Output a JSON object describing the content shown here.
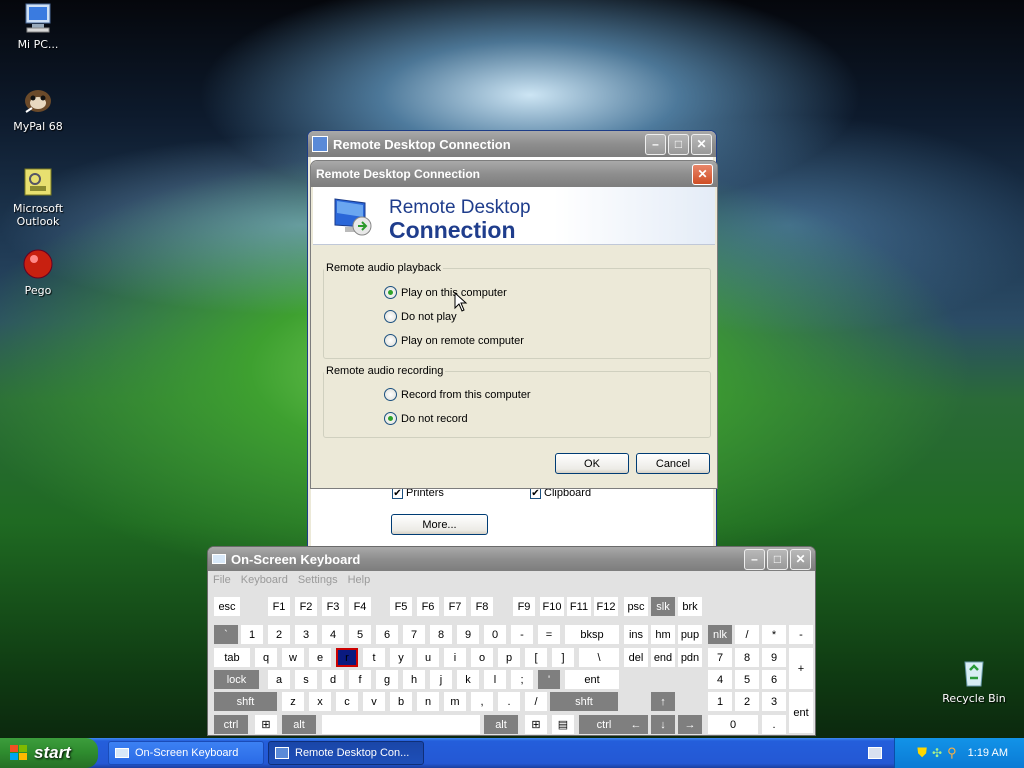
{
  "desktop": {
    "icons": [
      {
        "label": "Mi PC...",
        "icon": "my-computer-icon"
      },
      {
        "label": "MyPal 68",
        "icon": "mypal-browser-icon"
      },
      {
        "label": "Microsoft Outlook",
        "icon": "outlook-icon"
      },
      {
        "label": "Pego",
        "icon": "pego-icon"
      },
      {
        "label": "Recycle Bin",
        "icon": "recycle-bin-icon"
      }
    ]
  },
  "rdc_main": {
    "title": "Remote Desktop Connection",
    "printers_label": "Printers",
    "clipboard_label": "Clipboard",
    "more_button": "More..."
  },
  "audio_dialog": {
    "title": "Remote Desktop Connection",
    "header_line1": "Remote Desktop",
    "header_line2": "Connection",
    "playback_group": "Remote audio playback",
    "playback_options": [
      "Play on this computer",
      "Do not play",
      "Play on remote computer"
    ],
    "playback_selected": 0,
    "recording_group": "Remote audio recording",
    "recording_options": [
      "Record from this computer",
      "Do not record"
    ],
    "recording_selected": 1,
    "ok_button": "OK",
    "cancel_button": "Cancel"
  },
  "osk": {
    "title": "On-Screen Keyboard",
    "menu": [
      "File",
      "Keyboard",
      "Settings",
      "Help"
    ],
    "rows": {
      "r1": [
        "esc",
        "F1",
        "F2",
        "F3",
        "F4",
        "F5",
        "F6",
        "F7",
        "F8",
        "F9",
        "F10",
        "F11",
        "F12",
        "psc",
        "slk",
        "brk"
      ],
      "r2": [
        "`",
        "1",
        "2",
        "3",
        "4",
        "5",
        "6",
        "7",
        "8",
        "9",
        "0",
        "-",
        "=",
        "bksp",
        "ins",
        "hm",
        "pup",
        "nlk",
        "/",
        "*",
        "-"
      ],
      "r3": [
        "tab",
        "q",
        "w",
        "e",
        "r",
        "t",
        "y",
        "u",
        "i",
        "o",
        "p",
        "[",
        "]",
        "\\",
        "del",
        "end",
        "pdn",
        "7",
        "8",
        "9",
        "+"
      ],
      "r4": [
        "lock",
        "a",
        "s",
        "d",
        "f",
        "g",
        "h",
        "j",
        "k",
        "l",
        ";",
        "'",
        "ent",
        "4",
        "5",
        "6"
      ],
      "r5": [
        "shft",
        "z",
        "x",
        "c",
        "v",
        "b",
        "n",
        "m",
        ",",
        ".",
        "/",
        "shft",
        "↑",
        "1",
        "2",
        "3",
        "ent"
      ],
      "r6": [
        "ctrl",
        "⊞",
        "alt",
        "",
        "alt",
        "⊞",
        "▤",
        "ctrl",
        "←",
        "↓",
        "→",
        "0",
        "."
      ]
    }
  },
  "taskbar": {
    "start_label": "start",
    "tasks": [
      "On-Screen Keyboard",
      "Remote Desktop Con..."
    ],
    "active_task": 1,
    "clock": "1:19 AM"
  }
}
